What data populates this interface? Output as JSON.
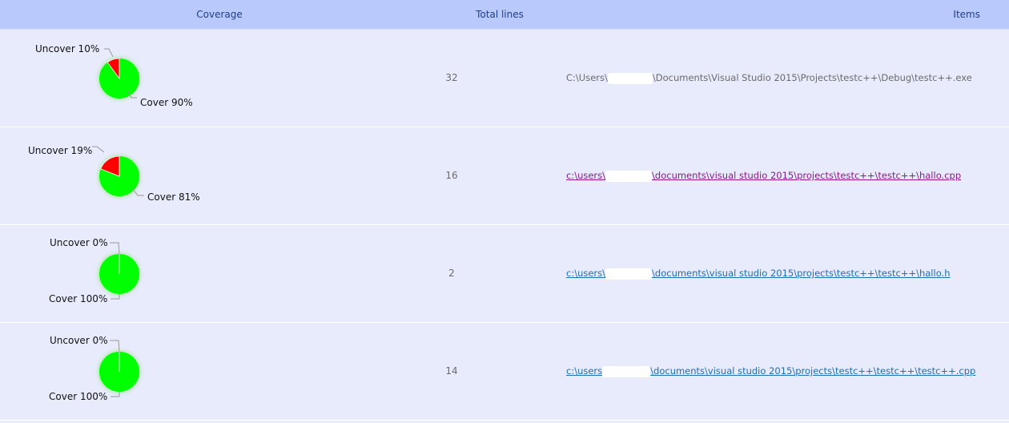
{
  "header": {
    "coverage": "Coverage",
    "total_lines": "Total lines",
    "items": "Items"
  },
  "colors": {
    "cover": "#00ff00",
    "uncover": "#ff0000",
    "header_bg": "#bac9fb",
    "row_bg": "#e8ebfc"
  },
  "rows": [
    {
      "uncover_pct": 10,
      "uncover_label": "Uncover 10%",
      "cover_label": "Cover 90%",
      "total_lines": "32",
      "path_prefix": "C:\\Users\\",
      "path_suffix": "\\Documents\\Visual Studio 2015\\Projects\\testc++\\Debug\\testc++.exe",
      "style": "plain"
    },
    {
      "uncover_pct": 19,
      "uncover_label": "Uncover 19%",
      "cover_label": "Cover 81%",
      "total_lines": "16",
      "path_prefix": "c:\\users\\",
      "path_suffix": "\\documents\\visual studio 2015\\projects\\testc++\\testc++\\hallo.cpp",
      "style": "visited"
    },
    {
      "uncover_pct": 0,
      "uncover_label": "Uncover 0%",
      "cover_label": "Cover 100%",
      "total_lines": "2",
      "path_prefix": "c:\\users\\",
      "path_suffix": "\\documents\\visual studio 2015\\projects\\testc++\\testc++\\hallo.h",
      "style": "link"
    },
    {
      "uncover_pct": 0,
      "uncover_label": "Uncover 0%",
      "cover_label": "Cover 100%",
      "total_lines": "14",
      "path_prefix": "c:\\users",
      "path_suffix": "\\documents\\visual studio 2015\\projects\\testc++\\testc++\\testc++.cpp",
      "style": "link"
    }
  ]
}
